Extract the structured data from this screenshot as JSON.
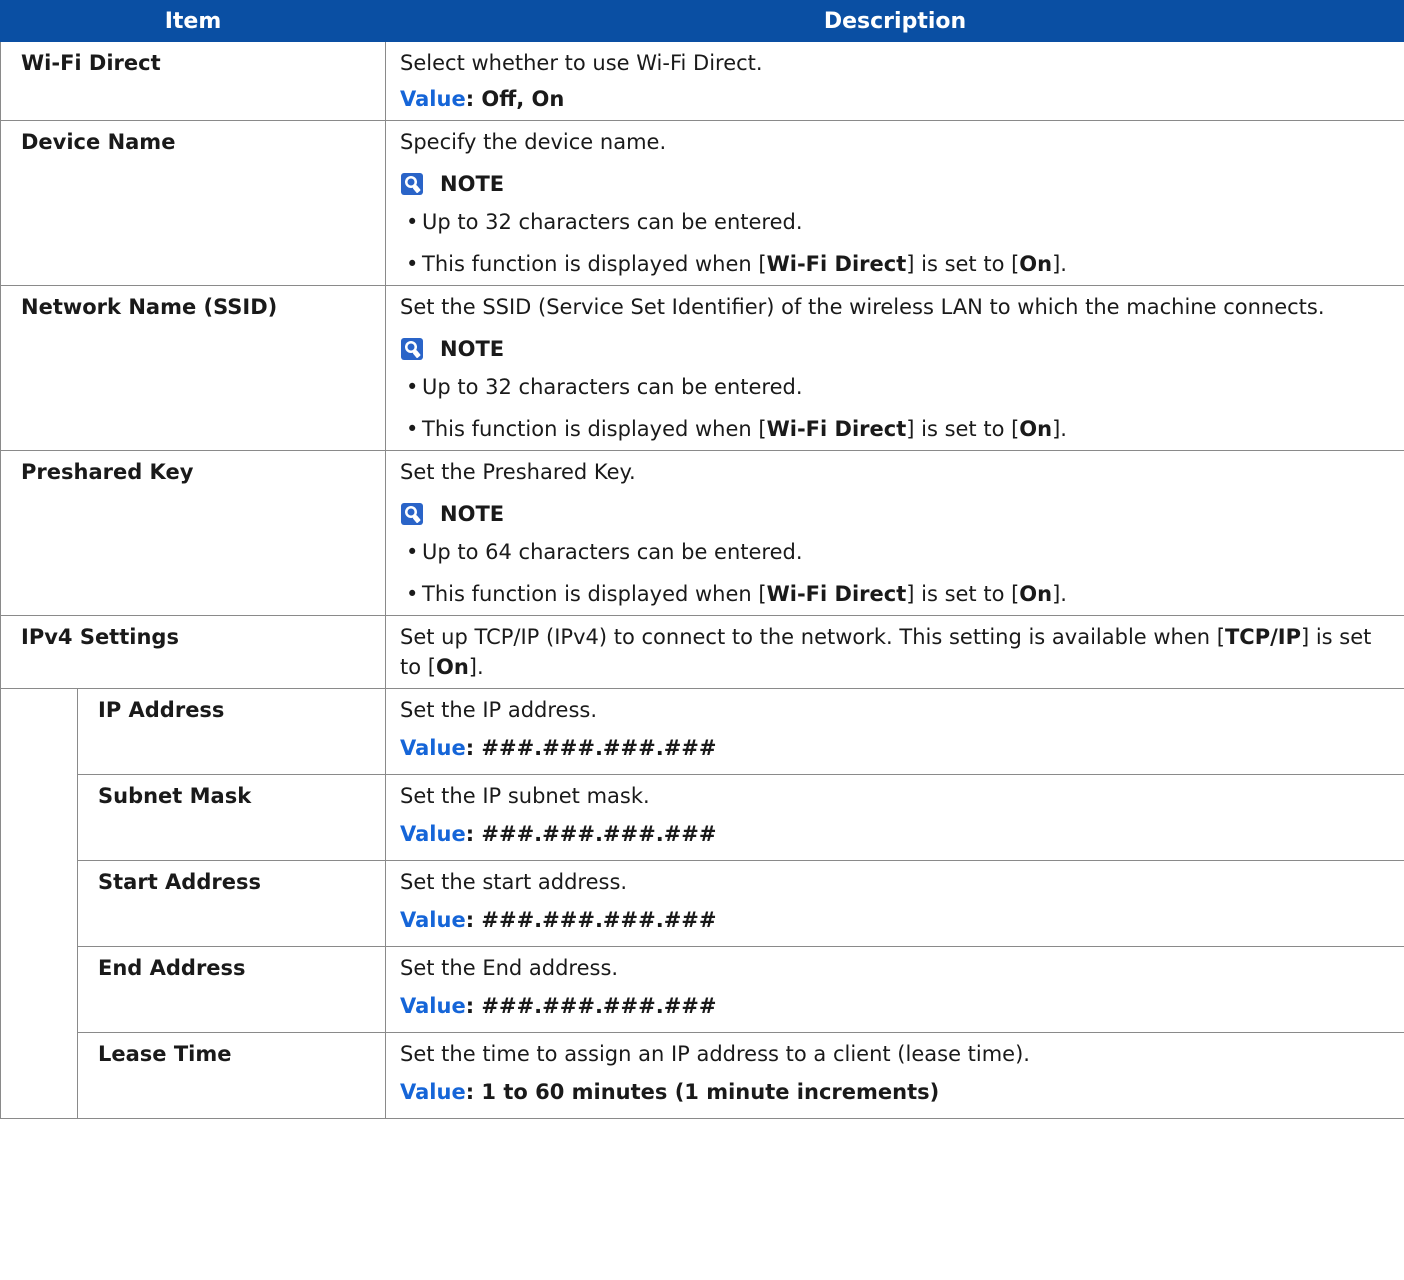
{
  "header": {
    "item": "Item",
    "description": "Description"
  },
  "note_label": "NOTE",
  "value_label": "Value",
  "rows": [
    {
      "item": "Wi-Fi Direct",
      "desc": "Select whether to use Wi-Fi Direct.",
      "value": ": Off, On"
    },
    {
      "item": "Device Name",
      "desc": "Specify the device name.",
      "notes": [
        "Up to 32 characters can be entered.",
        {
          "pre": "This function is displayed when [",
          "b1": "Wi-Fi Direct",
          "mid": "] is set to [",
          "b2": "On",
          "post": "]."
        }
      ]
    },
    {
      "item": "Network Name (SSID)",
      "desc": "Set the SSID (Service Set Identifier) of the wireless LAN to which the machine connects.",
      "notes": [
        "Up to 32 characters can be entered.",
        {
          "pre": "This function is displayed when [",
          "b1": "Wi-Fi Direct",
          "mid": "] is set to [",
          "b2": "On",
          "post": "]."
        }
      ]
    },
    {
      "item": "Preshared Key",
      "desc": "Set the Preshared Key.",
      "notes": [
        "Up to 64 characters can be entered.",
        {
          "pre": "This function is displayed when [",
          "b1": "Wi-Fi Direct",
          "mid": "] is set to [",
          "b2": "On",
          "post": "]."
        }
      ]
    },
    {
      "item": "IPv4 Settings",
      "desc": {
        "pre": "Set up TCP/IP (IPv4) to connect to the network. This setting is available when [",
        "b1": "TCP/IP",
        "mid": "] is set to [",
        "b2": "On",
        "post": "]."
      }
    }
  ],
  "subrows": [
    {
      "item": "IP Address",
      "desc": "Set the IP address.",
      "value": ": ###.###.###.###"
    },
    {
      "item": "Subnet Mask",
      "desc": "Set the IP subnet mask.",
      "value": ": ###.###.###.###"
    },
    {
      "item": "Start Address",
      "desc": "Set the start address.",
      "value": ": ###.###.###.###"
    },
    {
      "item": "End Address",
      "desc": "Set the End address.",
      "value": ": ###.###.###.###"
    },
    {
      "item": "Lease Time",
      "desc": "Set the time to assign an IP address to a client (lease time).",
      "value": ": 1 to 60 minutes (1 minute increments)"
    }
  ]
}
